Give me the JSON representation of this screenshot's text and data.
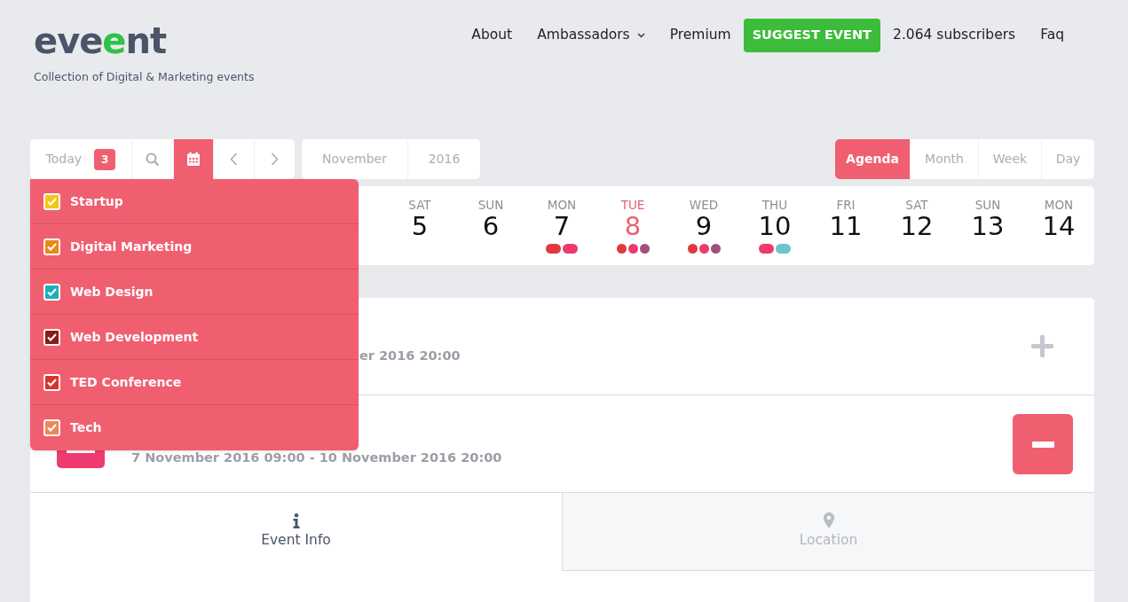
{
  "logo": {
    "parts": [
      {
        "text": "eve",
        "accent": false
      },
      {
        "text": "e",
        "accent": true
      },
      {
        "text": "nt",
        "accent": false
      }
    ]
  },
  "tagline": "Collection of Digital & Marketing events",
  "nav": [
    {
      "label": "About",
      "kind": "link"
    },
    {
      "label": "Ambassadors",
      "kind": "dropdown"
    },
    {
      "label": "Premium",
      "kind": "link"
    },
    {
      "label": "SUGGEST EVENT",
      "kind": "button"
    },
    {
      "label": "2.064 subscribers",
      "kind": "link"
    },
    {
      "label": "Faq",
      "kind": "link"
    }
  ],
  "toolbar": {
    "today": {
      "label": "Today",
      "count": "3"
    },
    "calendar_open": true,
    "month": "November",
    "year": "2016"
  },
  "views": [
    {
      "label": "Agenda",
      "selected": true
    },
    {
      "label": "Month",
      "selected": false
    },
    {
      "label": "Week",
      "selected": false
    },
    {
      "label": "Day",
      "selected": false
    }
  ],
  "categories": [
    {
      "label": "Startup",
      "checked": true,
      "color": "#f5c518"
    },
    {
      "label": "Digital Marketing",
      "checked": true,
      "color": "#e8891a"
    },
    {
      "label": "Web Design",
      "checked": true,
      "color": "#1bb0b8"
    },
    {
      "label": "Web Development",
      "checked": true,
      "color": "#8b1a1a"
    },
    {
      "label": "TED Conference",
      "checked": true,
      "color": "#d9342b"
    },
    {
      "label": "Tech",
      "checked": true,
      "color": "#f0855a"
    }
  ],
  "days": [
    {
      "weekday": "SAT",
      "day": "5",
      "selected": false
    },
    {
      "weekday": "SUN",
      "day": "6",
      "selected": false
    },
    {
      "weekday": "MON",
      "day": "7",
      "selected": false,
      "events": [
        {
          "color": "#e03a3a"
        },
        {
          "color": "#ee3a6e"
        }
      ]
    },
    {
      "weekday": "TUE",
      "day": "8",
      "selected": true,
      "events": [
        {
          "color": "#e03a3a"
        },
        {
          "color": "#ee3a6e"
        },
        {
          "color": "#a0507a"
        }
      ]
    },
    {
      "weekday": "WED",
      "day": "9",
      "selected": false,
      "events": [
        {
          "color": "#e03a3a"
        },
        {
          "color": "#ee3a6e"
        },
        {
          "color": "#a0507a"
        }
      ]
    },
    {
      "weekday": "THU",
      "day": "10",
      "selected": false,
      "events": [
        {
          "color": "#ee3a6e"
        },
        {
          "color": "#6cc4cc"
        }
      ]
    },
    {
      "weekday": "FRI",
      "day": "11",
      "selected": false
    },
    {
      "weekday": "SAT",
      "day": "12",
      "selected": false
    },
    {
      "weekday": "SUN",
      "day": "13",
      "selected": false
    },
    {
      "weekday": "MON",
      "day": "14",
      "selected": false
    }
  ],
  "events": [
    {
      "dates": "er 2016 20:00",
      "expanded": false
    },
    {
      "dates": "7 November 2016 09:00 - 10 November 2016 20:00",
      "expanded": true
    }
  ],
  "detail_tabs": [
    {
      "label": "Event Info",
      "kind": "info",
      "selected": true
    },
    {
      "label": "Location",
      "kind": "location",
      "selected": false
    }
  ]
}
